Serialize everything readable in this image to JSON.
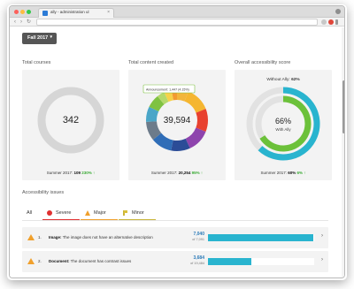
{
  "browser": {
    "tab_title": "ally - administration ul",
    "tab_close": "×",
    "back": "‹",
    "forward": "›",
    "reload": "↻",
    "traffic_colors": [
      "#fc605b",
      "#fdbc40",
      "#34c84a"
    ]
  },
  "term_selector": {
    "label": "Fall 2017",
    "caret": "▾"
  },
  "total_courses": {
    "title": "Total courses",
    "value": "342",
    "compare_label": "Summer 2017:",
    "compare_value": "109",
    "change": "230%",
    "arrow": "↑"
  },
  "total_content": {
    "title": "Total content created",
    "value": "39,594",
    "tooltip": "Announcement: 1,447 (4.15%)",
    "compare_label": "Summer 2017:",
    "compare_value": "20,254",
    "change": "95%",
    "arrow": "↑",
    "segment_fractions": [
      0.06,
      0.13,
      0.12,
      0.12,
      0.1,
      0.11,
      0.1,
      0.08,
      0.07,
      0.04,
      0.04,
      0.03
    ],
    "segment_colors": [
      "#f2b63c",
      "#f5b631",
      "#e8412f",
      "#8e44ad",
      "#2b4c97",
      "#2f6db7",
      "#6c7b8a",
      "#4aa6c8",
      "#7fc241",
      "#b4d96b",
      "#f6d24a",
      "#f29b32"
    ]
  },
  "accessibility_score": {
    "title": "Overall accessibility score",
    "without_label": "Without Ally:",
    "without_value": "62%",
    "value": "66%",
    "with_label": "With Ally",
    "without_fraction": 0.62,
    "with_fraction": 0.66,
    "compare_label": "Summer 2017:",
    "compare_value": "60%",
    "change": "6%",
    "arrow": "↑"
  },
  "issues_section": {
    "title": "Accessibility issues",
    "tabs": [
      {
        "label": "All",
        "color": "#ffffff"
      },
      {
        "label": "Severe",
        "color": "#e03131"
      },
      {
        "label": "Major",
        "color": "#f0a02c"
      },
      {
        "label": "Minor",
        "color": "#c9b53a"
      }
    ],
    "rows": [
      {
        "num": "1.",
        "title": "Image:",
        "text": "The image does not have an alternative description",
        "count": "7,040",
        "of": "of 7,091",
        "fill_fraction": 0.99
      },
      {
        "num": "2.",
        "title": "Document:",
        "text": "The document has contrast issues",
        "count": "3,684",
        "of": "of 19,484",
        "fill_fraction": 0.41
      }
    ],
    "chevron": "›"
  }
}
